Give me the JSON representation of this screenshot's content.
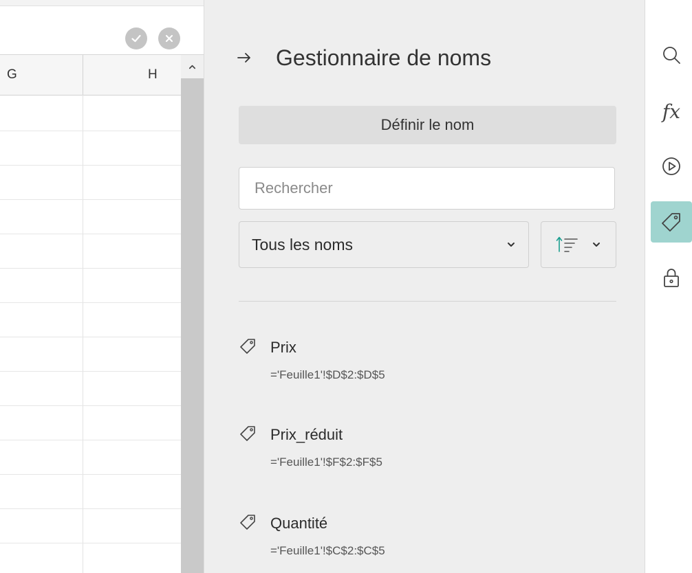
{
  "sheet": {
    "columns": [
      "G",
      "H"
    ]
  },
  "panel": {
    "title": "Gestionnaire de noms",
    "define_button": "Définir le nom",
    "search_placeholder": "Rechercher",
    "filter_selected": "Tous les noms",
    "names": [
      {
        "name": "Prix",
        "ref": "='Feuille1'!$D$2:$D$5"
      },
      {
        "name": "Prix_réduit",
        "ref": "='Feuille1'!$F$2:$F$5"
      },
      {
        "name": "Quantité",
        "ref": "='Feuille1'!$C$2:$C$5"
      }
    ]
  },
  "toolbar": {
    "icons": [
      "search-icon",
      "function-icon",
      "play-icon",
      "tag-icon",
      "lock-icon"
    ],
    "active": "tag-icon",
    "accent_color": "#9fd4cf"
  },
  "colors": {
    "panel_bg": "#eeeeee",
    "sort_icon_accent": "#1a9e8f"
  }
}
